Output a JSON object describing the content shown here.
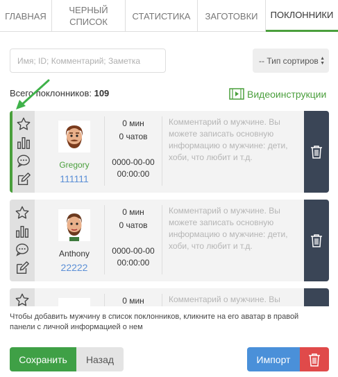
{
  "tabs": [
    {
      "label": "ГЛАВНАЯ",
      "active": false
    },
    {
      "label": "ЧЕРНЫЙ СПИСОК",
      "active": false
    },
    {
      "label": "СТАТИСТИКА",
      "active": false
    },
    {
      "label": "ЗАГОТОВКИ",
      "active": false
    },
    {
      "label": "ПОКЛОННИКИ",
      "active": true
    }
  ],
  "search": {
    "placeholder": "Имя; ID; Комментарий; Заметка",
    "value": ""
  },
  "sort": {
    "label": "-- Тип сортиров"
  },
  "summary": {
    "label": "Всего поклонников:",
    "count": "109"
  },
  "video_link": {
    "label": "Видеоинструкции"
  },
  "fans": [
    {
      "name": "Gregory",
      "id": "111111",
      "duration": "0 мин",
      "chats": "0 чатов",
      "date": "0000-00-00",
      "time": "00:00:00",
      "comment_placeholder": "Комментарий о мужчине. Вы можете записать основную информацию о мужчине: дети, хоби, что любит и т.д."
    },
    {
      "name": "Anthony",
      "id": "22222",
      "duration": "0 мин",
      "chats": "0 чатов",
      "date": "0000-00-00",
      "time": "00:00:00",
      "comment_placeholder": "Комментарий о мужчине. Вы можете записать основную информацию о мужчине: дети, хоби, что любит и т.д."
    },
    {
      "name": "",
      "id": "",
      "duration": "0 мин",
      "chats": "",
      "date": "",
      "time": "",
      "comment_placeholder": "Комментарий о мужчине. Вы"
    }
  ],
  "hint": "Чтобы добавить мужчину в список поклонников, кликните на его аватар в правой панели с личной информацией о нем",
  "buttons": {
    "save": "Сохранить",
    "back": "Назад",
    "import": "Импорт"
  },
  "colors": {
    "accent_green": "#4a9f3c",
    "save_green": "#3fa046",
    "import_blue": "#4a90d9",
    "delete_red": "#e04a4a",
    "trash_panel": "#3a4556",
    "id_blue": "#5b8fd6"
  },
  "icons": [
    "star-icon",
    "bar-chart-icon",
    "chat-icon",
    "edit-icon",
    "trash-icon",
    "film-icon"
  ]
}
